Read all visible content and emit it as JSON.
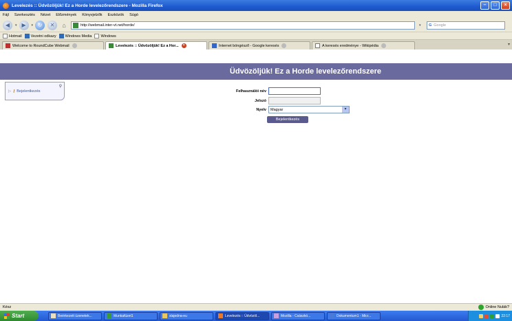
{
  "window": {
    "title": "Levelezés :: Üdvözöljük! Ez a Horde levelezőrendszere - Mozilla Firefox"
  },
  "menu": [
    "Fájl",
    "Szerkesztés",
    "Nézet",
    "Előzmények",
    "Könyvjelzők",
    "Eszközök",
    "Súgó"
  ],
  "nav": {
    "url": "http://webmail.inter-vt.net/horde/",
    "search_placeholder": "Google"
  },
  "bookmarks": [
    "Hotmail",
    "Vezetni odkazy",
    "Windows Media",
    "Windows"
  ],
  "tabs": [
    {
      "label": "Welcome to RoundCube Webmail",
      "active": false
    },
    {
      "label": "Levelezés :: Üdvözöljük! Ez a Hor...",
      "active": true
    },
    {
      "label": "Internet böngésző - Google keresés",
      "active": false
    },
    {
      "label": "A keresés eredménye - Wikipédia",
      "active": false
    }
  ],
  "page": {
    "header": "Üdvözöljük! Ez a Horde levelezőrendszere",
    "sidebar_login": "Bejelentkezés",
    "form": {
      "username_label": "Felhasználói név",
      "password_label": "Jelszó",
      "language_label": "Nyelv",
      "language_value": "Magyar",
      "submit_label": "Bejelentkezés"
    }
  },
  "status": {
    "text": "Kész",
    "online": "Online Nulák?"
  },
  "taskbar": {
    "start": "Start",
    "tasks": [
      "Beérkezett üzenetek...",
      "Munkafüzet1",
      "slajedna-eu",
      "Levelezés :: Üdvözöl...",
      "Mozilla - Császkó...",
      "Dokumentum1 - Micr..."
    ],
    "clock": "22:17"
  }
}
